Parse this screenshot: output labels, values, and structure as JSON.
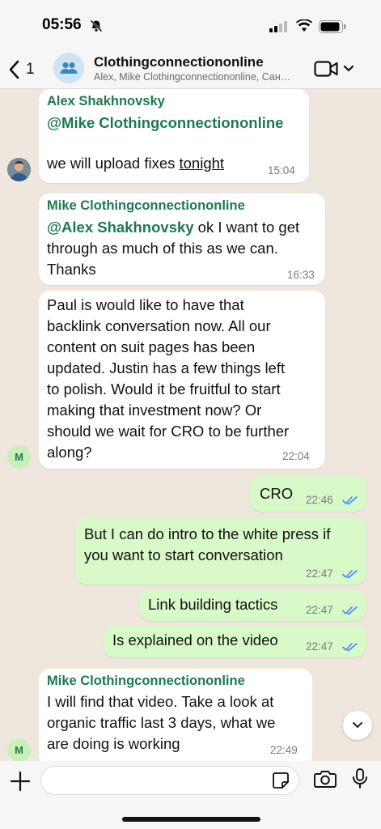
{
  "status": {
    "time": "05:56"
  },
  "header": {
    "back_count": "1",
    "title": "Clothingconnectiononline",
    "subtitle": "Alex, Mike Clothingconnectiononline, Сан…"
  },
  "messages": [
    {
      "sender": "Alex Shakhnovsky",
      "mention": "@Mike Clothingconnectiononline",
      "text": "we will upload fixes ",
      "text_underlined": "tonight",
      "time": "15:04"
    },
    {
      "sender": "Mike Clothingconnectiononline",
      "mention": "@Alex Shakhnovsky",
      "line1_rest": " ok I want to get",
      "line2": "through as much of this as we can.",
      "line3": "Thanks",
      "time": "16:33"
    },
    {
      "lines": [
        "Paul is would like to have that",
        "backlink conversation now. All our",
        "content on suit pages has been",
        "updated. Justin has a few things left",
        "to polish. Would it be fruitful to start",
        "making that investment now? Or",
        "should we wait for CRO to be further",
        "along?"
      ],
      "time": "22:04",
      "avatar": "M"
    },
    {
      "text": "CRO",
      "time": "22:46"
    },
    {
      "line1": "But I can do intro to the white press if",
      "line2": "you want to start conversation",
      "time": "22:47"
    },
    {
      "text": "Link building tactics",
      "time": "22:47"
    },
    {
      "text": "Is explained on the video",
      "time": "22:47"
    },
    {
      "sender": "Mike Clothingconnectiononline",
      "line1": "I will find that video. Take a look at",
      "line2": "organic traffic last 3 days, what we",
      "line3": "are doing is working",
      "time": "22:49",
      "avatar": "M"
    }
  ],
  "colors": {
    "incoming": "#ffffff",
    "outgoing": "#d8f9c8",
    "sender": "#1d7a4f",
    "ticks": "#3b8df2"
  }
}
